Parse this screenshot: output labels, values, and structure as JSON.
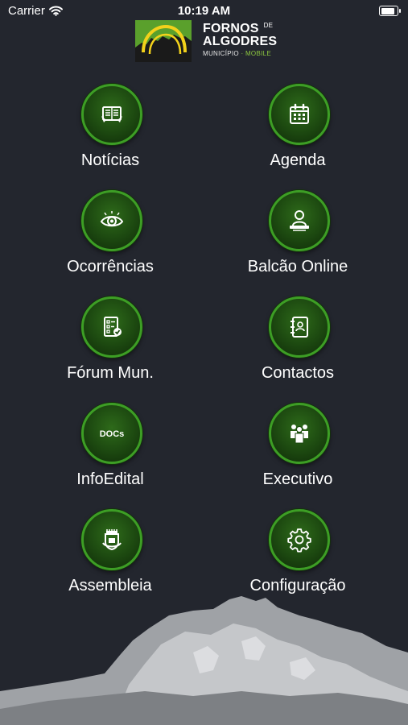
{
  "status_bar": {
    "carrier": "Carrier",
    "time": "10:19 AM",
    "battery_level": 0.95
  },
  "logo": {
    "line1": "FORNOS",
    "de": "DE",
    "line2": "ALGODRES",
    "sub_a": "MUNICÍPIO",
    "sub_sep": " · ",
    "sub_b": "MOBILE"
  },
  "menu": [
    {
      "label": "Notícias",
      "icon": "newspaper-icon"
    },
    {
      "label": "Agenda",
      "icon": "calendar-icon"
    },
    {
      "label": "Ocorrências",
      "icon": "eye-icon"
    },
    {
      "label": "Balcão Online",
      "icon": "counter-icon"
    },
    {
      "label": "Fórum Mun.",
      "icon": "checklist-icon"
    },
    {
      "label": "Contactos",
      "icon": "address-book-icon"
    },
    {
      "label": "InfoEdital",
      "icon": "docs-icon",
      "icon_text": "DOCs"
    },
    {
      "label": "Executivo",
      "icon": "group-icon"
    },
    {
      "label": "Assembleia",
      "icon": "coat-of-arms-icon"
    },
    {
      "label": "Configuração",
      "icon": "gear-icon"
    }
  ],
  "colors": {
    "background": "#23262e",
    "accent": "#3d9e25",
    "circle_fill": "#1c4810",
    "rock": "#9fa2a6"
  }
}
